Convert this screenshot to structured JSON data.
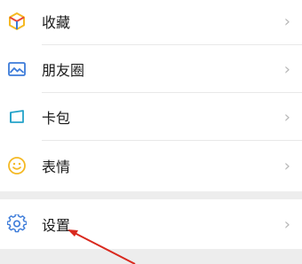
{
  "menu": {
    "items": [
      {
        "label": "收藏",
        "icon": "favorites-cube-icon"
      },
      {
        "label": "朋友圈",
        "icon": "moments-image-icon"
      },
      {
        "label": "卡包",
        "icon": "card-wallet-icon"
      },
      {
        "label": "表情",
        "icon": "sticker-smiley-icon"
      }
    ],
    "chevron": "›"
  },
  "settings": {
    "label": "设置",
    "icon": "gear-icon"
  },
  "colors": {
    "background": "#ededed",
    "row": "#ffffff",
    "icon_blue": "#3c7bd9",
    "icon_teal": "#25a3c9",
    "icon_yellow": "#f5b924",
    "annotation_red": "#d9291e"
  }
}
